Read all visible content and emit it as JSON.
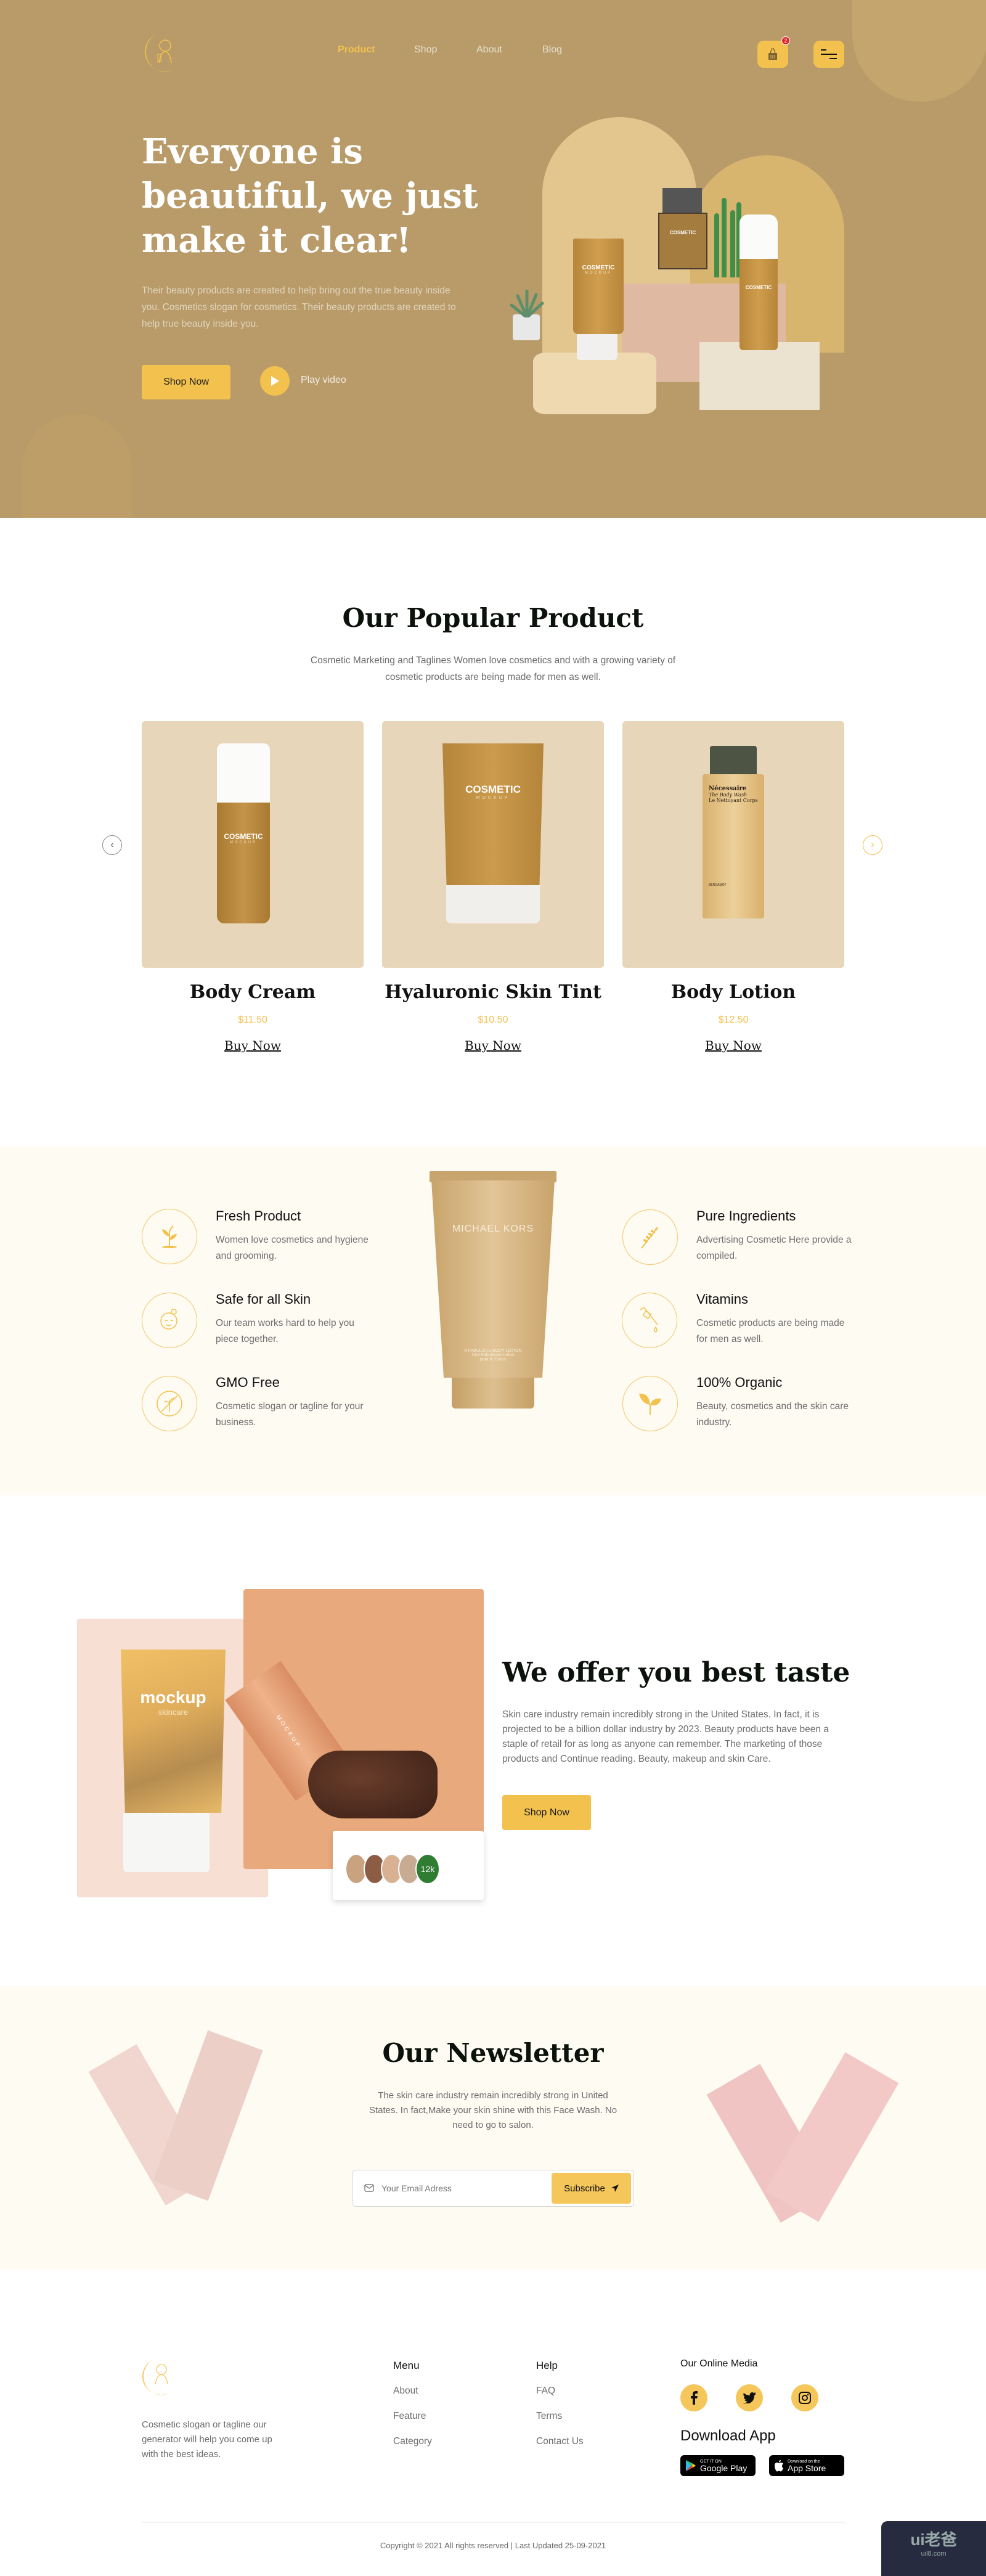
{
  "header": {
    "nav": [
      {
        "label": "Product",
        "active": true
      },
      {
        "label": "Shop",
        "active": false
      },
      {
        "label": "About",
        "active": false
      },
      {
        "label": "Blog",
        "active": false
      }
    ],
    "cart_count": "2",
    "cart_icon": "basket-icon",
    "menu_icon": "hamburger-menu-icon"
  },
  "hero": {
    "title": "Everyone is beautiful, we just make it clear!",
    "description": "Their beauty products are created to help bring out the true beauty inside you. Cosmetics slogan for cosmetics. Their beauty products are created to help true beauty inside you.",
    "shop_now": "Shop Now",
    "play_video": "Play video",
    "scene_labels": {
      "brand": "COSMETIC",
      "sub": "MOCKUP"
    }
  },
  "popular": {
    "title": "Our Popular Product",
    "subtitle": "Cosmetic Marketing and Taglines Women love cosmetics and with a growing variety of cosmetic products are being made for men as well.",
    "products": [
      {
        "name": "Body Cream",
        "price": "$11.50",
        "cta": "Buy Now",
        "label": "COSMETIC",
        "sublabel": "MOCKUP"
      },
      {
        "name": "Hyaluronic Skin Tint",
        "price": "$10.50",
        "cta": "Buy Now",
        "label": "COSMETIC",
        "sublabel": "MOCKUP"
      },
      {
        "name": "Body Lotion",
        "price": "$12.50",
        "cta": "Buy Now",
        "label": "Nécessaire",
        "sublabel": "The Body Wash",
        "sublabel2": "Le Nettoyant Corps",
        "footer": "BERGAMOT"
      }
    ]
  },
  "features": {
    "center_product": {
      "brand": "MICHAEL KORS",
      "line1": "A FABULOUS BODY LOTION",
      "line2": "Une Fabuleuse Lotion",
      "line3": "pour le Corps"
    },
    "left": [
      {
        "icon": "sprout-icon",
        "title": "Fresh Product",
        "desc": "Women love cosmetics and hygiene and grooming."
      },
      {
        "icon": "face-care-icon",
        "title": "Safe for all Skin",
        "desc": "Our team works hard to help you piece together."
      },
      {
        "icon": "no-gmo-icon",
        "title": "GMO Free",
        "desc": "Cosmetic slogan or tagline for your business."
      }
    ],
    "right": [
      {
        "icon": "wheat-icon",
        "title": "Pure Ingredients",
        "desc": "Advertising Cosmetic Here provide a compiled."
      },
      {
        "icon": "dropper-icon",
        "title": "Vitamins",
        "desc": "Cosmetic products are being made for men as well."
      },
      {
        "icon": "leaf-icon",
        "title": "100% Organic",
        "desc": "Beauty, cosmetics and the skin care industry."
      }
    ]
  },
  "offer": {
    "title": "We offer you best taste",
    "description": "Skin care industry remain incredibly strong in the United States. In fact, it is projected to be a billion dollar industry by 2023. Beauty products have been a staple of retail for as long as anyone can remember. The marketing of those products and Continue reading. Beauty, makeup and skin Care.",
    "cta": "Shop Now",
    "tube1_label": "mockup",
    "tube1_sub": "skincare",
    "tube2_label": "MOCKUP",
    "customers_count": "12k"
  },
  "newsletter": {
    "title": "Our Newsletter",
    "description": "The skin care industry remain incredibly strong in United States. In fact,Make your skin shine with this Face Wash. No need to go to salon.",
    "email_placeholder": "Your Email Adress",
    "subscribe": "Subscribe"
  },
  "footer": {
    "tagline": "Cosmetic slogan or tagline our generator will help you come up with the best ideas.",
    "menu_title": "Menu",
    "menu": [
      "About",
      "Feature",
      "Category"
    ],
    "help_title": "Help",
    "help": [
      "FAQ",
      "Terms",
      "Contact Us"
    ],
    "media_title": "Our Online Media",
    "social": [
      "facebook-icon",
      "twitter-icon",
      "instagram-icon"
    ],
    "download_title": "Download App",
    "google_top": "GET IT ON",
    "google_bottom": "Google Play",
    "apple_top": "Download on the",
    "apple_bottom": "App Store",
    "copyright": "Copyright © 2021 All rights reserved | Last Updated 25-09-2021"
  },
  "watermark": {
    "title": "ui老爸",
    "url": "uil8.com"
  },
  "colors": {
    "accent": "#f2c14e",
    "hero_bg": "#b89b69",
    "card_bg": "#e7d6b9",
    "cream_bg": "#fefbf3",
    "badge": "#e0262b",
    "avatar_count_bg": "#2e7d32"
  }
}
